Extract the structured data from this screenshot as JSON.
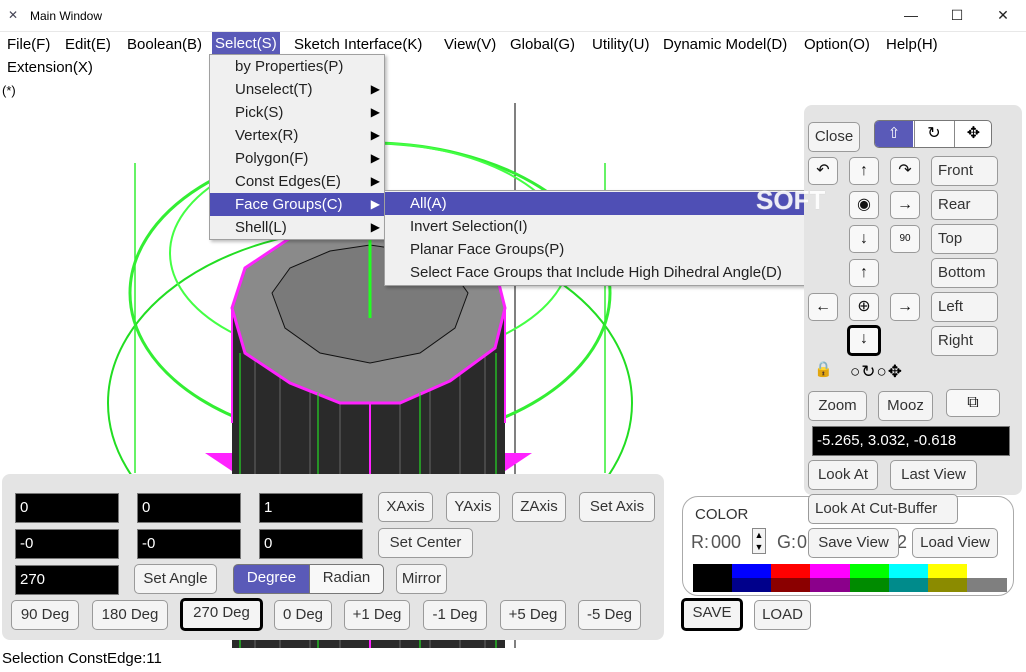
{
  "window": {
    "title": "Main Window",
    "minimize": "—",
    "maximize": "☐",
    "close": "✕"
  },
  "menubar": {
    "items": [
      "File(F)",
      "Edit(E)",
      "Boolean(B)",
      "Select(S)",
      "Sketch Interface(K)",
      "View(V)",
      "Global(G)",
      "Utility(U)",
      "Dynamic Model(D)",
      "Option(O)",
      "Help(H)",
      "Extension(X)"
    ]
  },
  "modified_marker": "(*)",
  "select_menu": {
    "items": [
      "by Properties(P)",
      "Unselect(T)",
      "Pick(S)",
      "Vertex(R)",
      "Polygon(F)",
      "Const Edges(E)",
      "Face Groups(C)",
      "Shell(L)"
    ],
    "highlighted": "Face Groups(C)"
  },
  "face_groups_submenu": {
    "items": [
      "All(A)",
      "Invert Selection(I)",
      "Planar Face Groups(P)",
      "Select Face Groups that Include High Dihedral Angle(D)"
    ],
    "highlighted": "All(A)"
  },
  "watermark": "SOFT",
  "view_panel": {
    "close": "Close",
    "front": "Front",
    "rear": "Rear",
    "top": "Top",
    "bottom": "Bottom",
    "left": "Left",
    "right": "Right",
    "zoom": "Zoom",
    "mooz": "Mooz",
    "coords": "-5.265, 3.032, -0.618",
    "look_at": "Look At",
    "last_view": "Last View",
    "look_at_cut_buffer": "Look At Cut-Buffer",
    "save_view": "Save View",
    "load_view": "Load View",
    "btn_90": "90"
  },
  "color_panel": {
    "label": "COLOR",
    "r_label": "R:",
    "r_value": "000",
    "g_label": "G:",
    "g_value": "0",
    "b_value": "2",
    "save": "SAVE",
    "load": "LOAD",
    "palette": [
      "#000000",
      "#0000ff",
      "#ff0000",
      "#ff00ff",
      "#00ff00",
      "#00ffff",
      "#ffff00",
      "#ffffff"
    ],
    "palette_dark": [
      "#000000",
      "#00008b",
      "#8b0000",
      "#8b008b",
      "#008b00",
      "#008b8b",
      "#8b8b00",
      "#7f7f7f"
    ]
  },
  "transform_panel": {
    "fields": [
      "0",
      "0",
      "1",
      "-0",
      "-0",
      "0"
    ],
    "xaxis": "XAxis",
    "yaxis": "YAxis",
    "zaxis": "ZAxis",
    "set_axis": "Set Axis",
    "set_center": "Set Center",
    "angle": "270",
    "set_angle": "Set Angle",
    "degree": "Degree",
    "radian": "Radian",
    "mirror": "Mirror",
    "presets": [
      "90 Deg",
      "180 Deg",
      "270 Deg",
      "0 Deg",
      "+1 Deg",
      "-1 Deg",
      "+5 Deg",
      "-5 Deg"
    ]
  },
  "status": {
    "text": "Selection  ConstEdge:11"
  }
}
